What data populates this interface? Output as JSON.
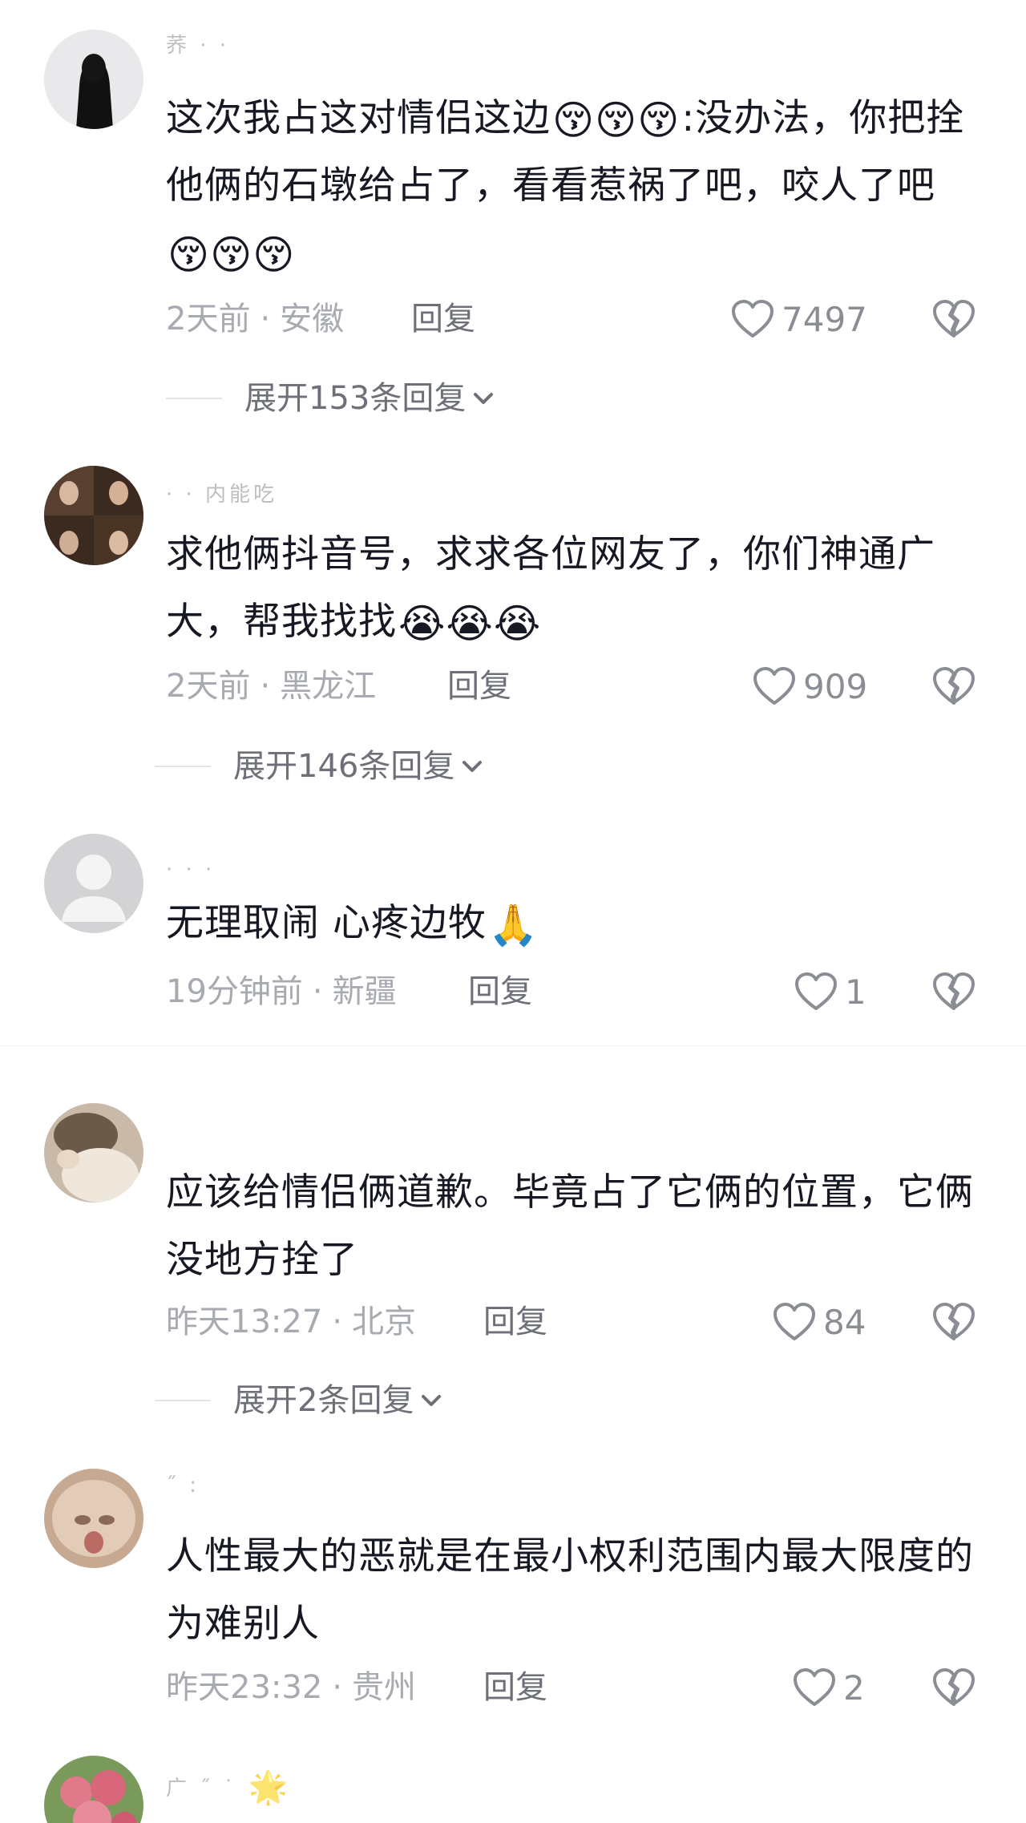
{
  "comments": [
    {
      "username": "荞 · ·",
      "content": "这次我占这对情侣这边",
      "emoji_a": "😚😚😚",
      "content_b": ":没办法，你把拴他俩的石墩给占了，看看惹祸了吧，咬人了吧",
      "emoji_b": "😚😚😚",
      "time": "2天前",
      "location": "安徽",
      "reply_label": "回复",
      "likes": "7497",
      "expand_label": "展开153条回复"
    },
    {
      "username": "· · 内能吃",
      "content": "求他俩抖音号，求求各位网友了，你们神通广大，帮我找找",
      "emoji_b": "😭😭😭",
      "time": "2天前",
      "location": "黑龙江",
      "reply_label": "回复",
      "likes": "909",
      "expand_label": "展开146条回复"
    },
    {
      "username": "· · ·",
      "content": "无理取闹 心疼边牧",
      "emoji_b": "🙏",
      "time": "19分钟前",
      "location": "新疆",
      "reply_label": "回复",
      "likes": "1"
    },
    {
      "content": "应该给情侣俩道歉。毕竟占了它俩的位置，它俩没地方拴了",
      "time": "昨天13:27",
      "location": "北京",
      "reply_label": "回复",
      "likes": "84",
      "expand_label": "展开2条回复"
    },
    {
      "username": "˝ :",
      "content": "人性最大的恶就是在最小权利范围内最大限度的为难别人",
      "time": "昨天23:32",
      "location": "贵州",
      "reply_label": "回复",
      "likes": "2"
    },
    {
      "username": "广 ˝ ˙",
      "emoji_name": "🌟"
    }
  ],
  "icons": {
    "like": "heart-outline-icon",
    "dislike": "broken-heart-icon",
    "expand": "chevron-down-icon"
  },
  "colors": {
    "text": "#161823",
    "meta": "#a7aab0",
    "action": "#6e7079",
    "icon": "#8a8d94"
  }
}
